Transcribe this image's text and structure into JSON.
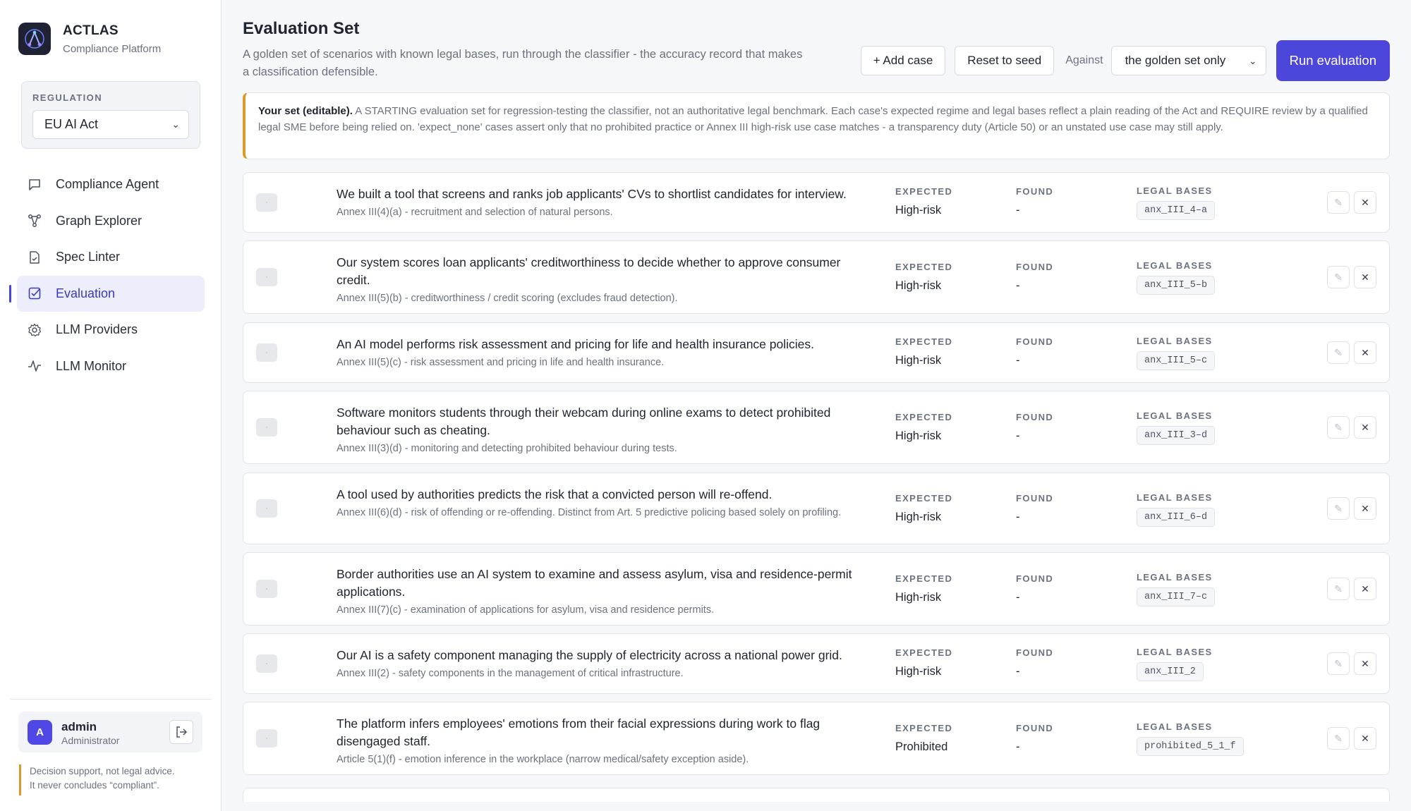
{
  "app": {
    "name": "ACTLAS",
    "subtitle": "Compliance Platform"
  },
  "regulation": {
    "label": "REGULATION",
    "selected": "EU AI Act"
  },
  "nav": [
    {
      "label": "Compliance Agent",
      "icon": "chat-icon",
      "active": false
    },
    {
      "label": "Graph Explorer",
      "icon": "graph-icon",
      "active": false
    },
    {
      "label": "Spec Linter",
      "icon": "file-check-icon",
      "active": false
    },
    {
      "label": "Evaluation",
      "icon": "checkbox-icon",
      "active": true
    },
    {
      "label": "LLM Providers",
      "icon": "gear-icon",
      "active": false
    },
    {
      "label": "LLM Monitor",
      "icon": "pulse-icon",
      "active": false
    }
  ],
  "user": {
    "initial": "A",
    "name": "admin",
    "role": "Administrator"
  },
  "disclaimer": {
    "line1": "Decision support, not legal advice.",
    "line2": "It never concludes “compliant”."
  },
  "page": {
    "title": "Evaluation Set",
    "description": "A golden set of scenarios with known legal bases, run through the classifier - the accuracy record that makes a classification defensible."
  },
  "toolbar": {
    "add_case": "+ Add case",
    "reset": "Reset to seed",
    "against_label": "Against",
    "against_selected": "the golden set only",
    "run": "Run evaluation"
  },
  "notice": {
    "strong": "Your set (editable).",
    "text": " A STARTING evaluation set for regression-testing the classifier, not an authoritative legal benchmark. Each case's expected regime and legal bases reflect a plain reading of the Act and REQUIRE review by a qualified legal SME before being relied on. 'expect_none' cases assert only that no prohibited practice or Annex III high-risk use case matches - a transparency duty (Article 50) or an unstated use case may still apply."
  },
  "columns": {
    "expected": "EXPECTED",
    "found": "FOUND",
    "bases": "LEGAL BASES"
  },
  "cases": [
    {
      "check": "·",
      "title": "We built a tool that screens and ranks job applicants' CVs to shortlist candidates for interview.",
      "sub": "Annex III(4)(a) - recruitment and selection of natural persons.",
      "expected": "High-risk",
      "found": "-",
      "basis": "anx_III_4–a"
    },
    {
      "check": "·",
      "title": "Our system scores loan applicants' creditworthiness to decide whether to approve consumer credit.",
      "sub": "Annex III(5)(b) - creditworthiness / credit scoring (excludes fraud detection).",
      "expected": "High-risk",
      "found": "-",
      "basis": "anx_III_5–b"
    },
    {
      "check": "·",
      "title": "An AI model performs risk assessment and pricing for life and health insurance policies.",
      "sub": "Annex III(5)(c) - risk assessment and pricing in life and health insurance.",
      "expected": "High-risk",
      "found": "-",
      "basis": "anx_III_5–c"
    },
    {
      "check": "·",
      "title": "Software monitors students through their webcam during online exams to detect prohibited behaviour such as cheating.",
      "sub": "Annex III(3)(d) - monitoring and detecting prohibited behaviour during tests.",
      "expected": "High-risk",
      "found": "-",
      "basis": "anx_III_3–d"
    },
    {
      "check": "·",
      "title": "A tool used by authorities predicts the risk that a convicted person will re-offend.",
      "sub": "Annex III(6)(d) - risk of offending or re-offending. Distinct from Art. 5 predictive policing based solely on profiling.",
      "expected": "High-risk",
      "found": "-",
      "basis": "anx_III_6–d"
    },
    {
      "check": "·",
      "title": "Border authorities use an AI system to examine and assess asylum, visa and residence-permit applications.",
      "sub": "Annex III(7)(c) - examination of applications for asylum, visa and residence permits.",
      "expected": "High-risk",
      "found": "-",
      "basis": "anx_III_7–c"
    },
    {
      "check": "·",
      "title": "Our AI is a safety component managing the supply of electricity across a national power grid.",
      "sub": "Annex III(2) - safety components in the management of critical infrastructure.",
      "expected": "High-risk",
      "found": "-",
      "basis": "anx_III_2"
    },
    {
      "check": "·",
      "title": "The platform infers employees' emotions from their facial expressions during work to flag disengaged staff.",
      "sub": "Article 5(1)(f) - emotion inference in the workplace (narrow medical/safety exception aside).",
      "expected": "Prohibited",
      "found": "-",
      "basis": "prohibited_5_1_f"
    }
  ],
  "icons": {
    "edit": "pencil-icon",
    "delete": "close-icon",
    "logout": "logout-icon",
    "select": "chevron-down-icon"
  },
  "colors": {
    "accent": "#4c46db",
    "warning": "#d99a2b",
    "active_nav_bg": "#eceefb"
  }
}
